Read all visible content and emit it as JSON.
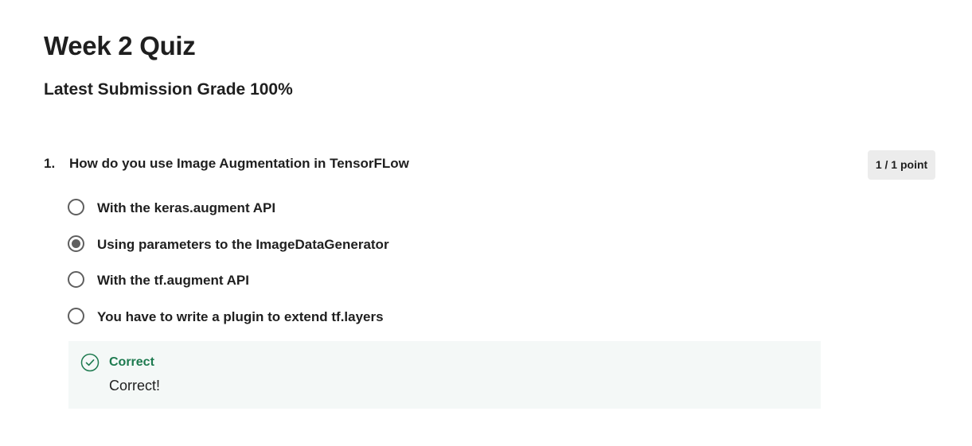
{
  "quiz": {
    "title": "Week 2 Quiz",
    "grade_line": "Latest Submission Grade 100%"
  },
  "question": {
    "number": "1.",
    "text": "How do you use Image Augmentation in TensorFLow",
    "points": "1 / 1 point",
    "options": [
      {
        "label": "With the keras.augment API",
        "selected": false
      },
      {
        "label": "Using parameters to the ImageDataGenerator",
        "selected": true
      },
      {
        "label": "With the tf.augment API",
        "selected": false
      },
      {
        "label": "You have to write a plugin to extend tf.layers",
        "selected": false
      }
    ],
    "feedback": {
      "status": "Correct",
      "message": "Correct!",
      "color": "#1d7a4f"
    }
  }
}
